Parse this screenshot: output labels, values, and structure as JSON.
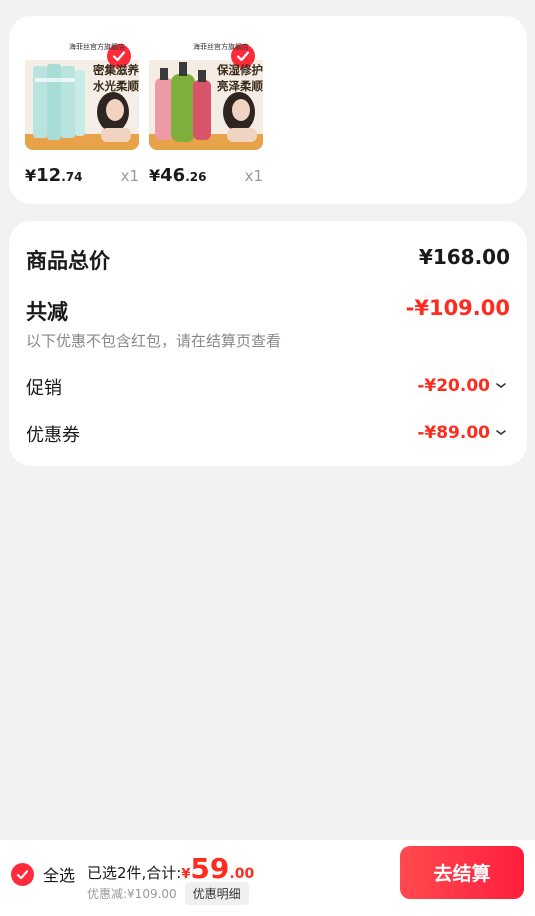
{
  "products": [
    {
      "name": "facial-cleanser",
      "banner_line1": "密集滋养",
      "banner_line2": "水光柔顺",
      "tag": "海菲丝官方旗舰店",
      "price_currency": "¥",
      "price_int": "12",
      "price_dec": ".74",
      "qty": "x1",
      "checked": true
    },
    {
      "name": "shampoo",
      "banner_line1": "保湿修护",
      "banner_line2": "亮泽柔顺",
      "tag": "海菲丝官方旗舰店",
      "price_currency": "¥",
      "price_int": "46",
      "price_dec": ".26",
      "qty": "x1",
      "checked": true
    }
  ],
  "summary": {
    "total_label": "商品总价",
    "total_value": "¥168.00",
    "reduce_label": "共减",
    "reduce_value": "-¥109.00",
    "reduce_note": "以下优惠不包含红包，请在结算页查看",
    "promo_label": "促销",
    "promo_value": "-¥20.00",
    "coupon_label": "优惠券",
    "coupon_value": "-¥89.00"
  },
  "bottom": {
    "select_all": "全选",
    "selected_text": "已选2件,合计:",
    "total_currency": "¥",
    "total_int": "59",
    "total_dec": ".00",
    "discount_text": "优惠减:¥109.00",
    "detail_button": "优惠明细",
    "checkout_button": "去结算"
  },
  "colors": {
    "accent": "#ff2b3a",
    "price_red": "#ff2b1e",
    "background": "#f2f2f2"
  }
}
